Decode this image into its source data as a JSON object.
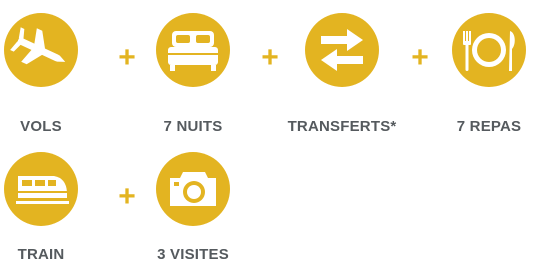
{
  "theme": {
    "accent": "#e3b421",
    "label_color": "#555a5e"
  },
  "items": [
    {
      "label": "VOLS",
      "icon": "airplane-icon"
    },
    {
      "label": "7 NUITS",
      "icon": "bed-icon"
    },
    {
      "label": "TRANSFERTS*",
      "icon": "transfer-arrows-icon"
    },
    {
      "label": "7 REPAS",
      "icon": "meal-icon"
    },
    {
      "label": "TRAIN",
      "icon": "train-icon"
    },
    {
      "label": "3 VISITES",
      "icon": "camera-icon"
    }
  ],
  "separator": "+"
}
